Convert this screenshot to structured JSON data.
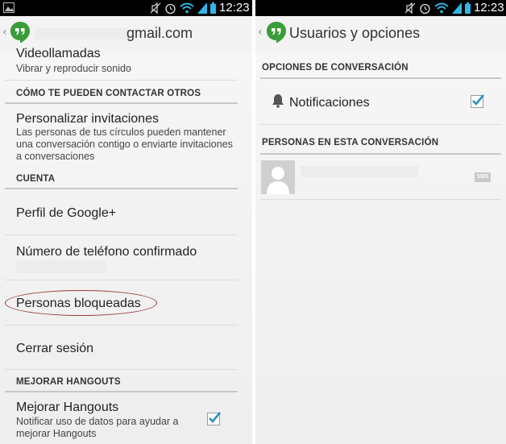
{
  "left": {
    "status_time": "12:23",
    "account_suffix": "gmail.com",
    "rows": {
      "video_title": "Videollamadas",
      "video_sub": "Vibrar y reproducir sonido",
      "contact_section": "CÓMO TE PUEDEN CONTACTAR OTROS",
      "invites_title": "Personalizar invitaciones",
      "invites_sub": "Las personas de tus círculos pueden mantener una conversación contigo o enviarte invitaciones a conversaciones",
      "account_section": "CUENTA",
      "profile_title": "Perfil de Google+",
      "phone_title": "Número de teléfono confirmado",
      "blocked_title": "Personas bloqueadas",
      "signout_title": "Cerrar sesión",
      "improve_section": "MEJORAR HANGOUTS",
      "improve_title": "Mejorar Hangouts",
      "improve_sub": "Notificar uso de datos para ayudar a mejorar Hangouts"
    },
    "improve_checked": true
  },
  "right": {
    "status_time": "12:23",
    "title": "Usuarios y opciones",
    "conv_section": "OPCIONES DE CONVERSACIÓN",
    "notif_title": "Notificaciones",
    "notif_checked": true,
    "people_section": "PERSONAS EN ESTA CONVERSACIÓN",
    "sms_badge": "SMS"
  },
  "colors": {
    "hangouts_green": "#3a9c3a",
    "check_blue": "#2a8fc0",
    "highlight_oval": "#9b3b3b"
  },
  "icons": [
    "image-icon",
    "mute-icon",
    "alarm-icon",
    "wifi-icon",
    "signal-icon",
    "battery-icon",
    "back-chevron-icon",
    "hangouts-logo-icon",
    "bell-icon",
    "check-icon",
    "avatar-icon"
  ]
}
